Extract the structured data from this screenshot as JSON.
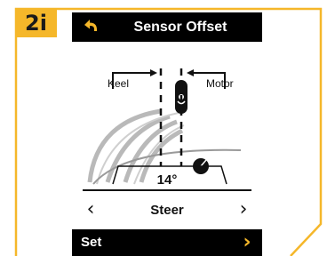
{
  "step_badge": "2i",
  "screen": {
    "title": "Sensor Offset",
    "diagram": {
      "keel_label": "Keel",
      "motor_label": "Motor",
      "angle_value": "14°"
    },
    "nav": {
      "left_glyph": "‹",
      "label": "Steer",
      "right_glyph": "›"
    },
    "set_bar": {
      "label": "Set",
      "chevron_glyph": "›"
    }
  },
  "colors": {
    "accent": "#f5b72a",
    "bar": "#000000"
  },
  "icons": {
    "back": "back-arrow-icon"
  }
}
